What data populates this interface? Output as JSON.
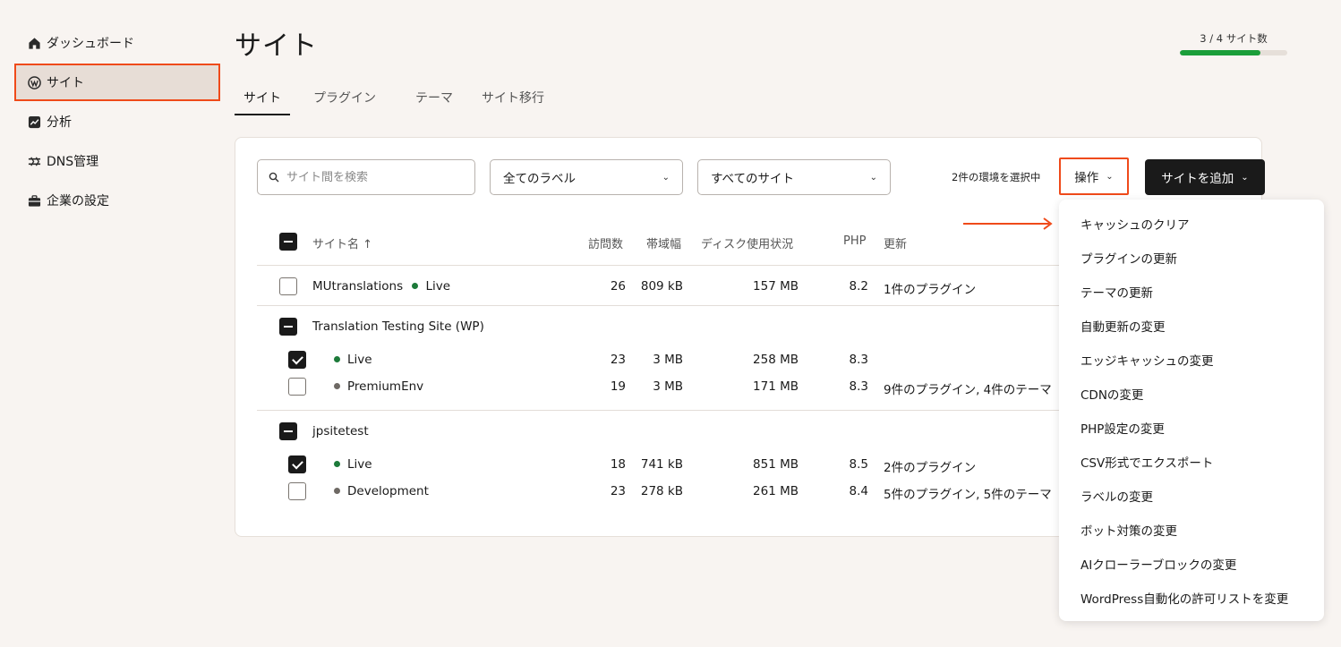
{
  "sidebar": {
    "items": [
      {
        "label": "ダッシュボード",
        "icon": "home-icon"
      },
      {
        "label": "サイト",
        "icon": "wordpress-icon",
        "active": true
      },
      {
        "label": "分析",
        "icon": "analytics-icon"
      },
      {
        "label": "DNS管理",
        "icon": "dns-icon"
      },
      {
        "label": "企業の設定",
        "icon": "briefcase-icon"
      }
    ]
  },
  "header": {
    "title": "サイト",
    "site_count": "3 / 4 サイト数",
    "site_usage": 0.75
  },
  "tabs": [
    "サイト",
    "プラグイン",
    "テーマ",
    "サイト移行"
  ],
  "toolbar": {
    "search_placeholder": "サイト間を検索",
    "label_filter": "全てのラベル",
    "site_filter": "すべてのサイト",
    "selected_text": "2件の環境を選択中",
    "action_label": "操作",
    "add_site_label": "サイトを追加"
  },
  "table": {
    "headers": {
      "site_name": "サイト名 ↑",
      "visits": "訪問数",
      "bandwidth": "帯域幅",
      "disk": "ディスク使用状況",
      "php": "PHP",
      "updates": "更新"
    },
    "site1": {
      "name": "MUtranslations",
      "env": "Live",
      "visits": "26",
      "bandwidth": "809 kB",
      "disk": "157 MB",
      "php": "8.2",
      "updates": "1件のプラグイン"
    },
    "site2": {
      "name": "Translation Testing Site (WP)",
      "env1": {
        "name": "Live",
        "visits": "23",
        "bandwidth": "3 MB",
        "disk": "258 MB",
        "php": "8.3",
        "updates": ""
      },
      "env2": {
        "name": "PremiumEnv",
        "visits": "19",
        "bandwidth": "3 MB",
        "disk": "171 MB",
        "php": "8.3",
        "updates": "9件のプラグイン, 4件のテーマ"
      }
    },
    "site3": {
      "name": "jpsitetest",
      "env1": {
        "name": "Live",
        "visits": "18",
        "bandwidth": "741 kB",
        "disk": "851 MB",
        "php": "8.5",
        "updates": "2件のプラグイン"
      },
      "env2": {
        "name": "Development",
        "visits": "23",
        "bandwidth": "278 kB",
        "disk": "261 MB",
        "php": "8.4",
        "updates": "5件のプラグイン, 5件のテーマ"
      }
    }
  },
  "menu": {
    "items": [
      "キャッシュのクリア",
      "プラグインの更新",
      "テーマの更新",
      "自動更新の変更",
      "エッジキャッシュの変更",
      "CDNの変更",
      "PHP設定の変更",
      "CSV形式でエクスポート",
      "ラベルの変更",
      "ボット対策の変更",
      "AIクローラーブロックの変更",
      "WordPress自動化の許可リストを変更"
    ]
  },
  "colors": {
    "accent": "#ef4a1a",
    "live": "#1d7a3a",
    "progress": "#1b9e3a"
  }
}
